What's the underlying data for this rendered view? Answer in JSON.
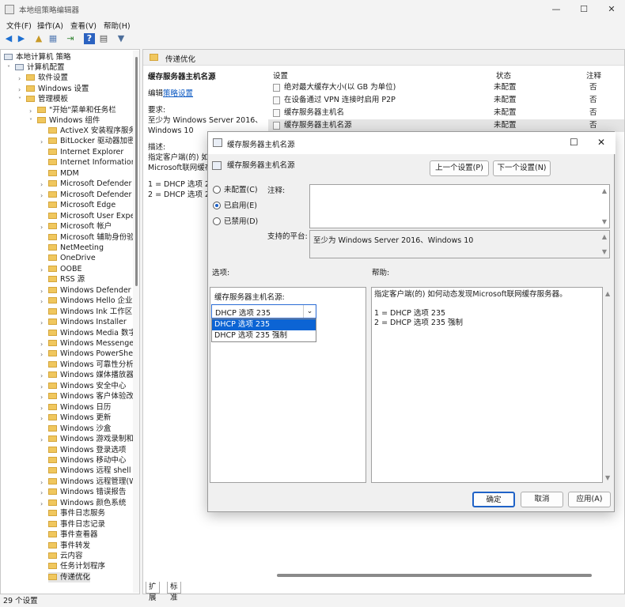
{
  "window": {
    "title": "本地组策略编辑器",
    "minimize": "—",
    "maximize": "☐",
    "close": "✕"
  },
  "menu": [
    "文件(F)",
    "操作(A)",
    "查看(V)",
    "帮助(H)"
  ],
  "tree": {
    "root": "本地计算机 策略",
    "computer_config": "计算机配置",
    "software_settings": "软件设置",
    "windows_settings": "Windows 设置",
    "admin_templates": "管理模板",
    "start_menu": "\"开始\"菜单和任务栏",
    "windows_components": "Windows 组件",
    "items": [
      "ActiveX 安装程序服务",
      "BitLocker 驱动器加密",
      "Internet Explorer",
      "Internet Information S",
      "MDM",
      "Microsoft Defender 攻",
      "Microsoft Defender 防",
      "Microsoft Edge",
      "Microsoft User Experie",
      "Microsoft 帐户",
      "Microsoft 辅助身份验证",
      "NetMeeting",
      "OneDrive",
      "OOBE",
      "RSS 源",
      "Windows Defender Sr",
      "Windows Hello 企业版",
      "Windows Ink 工作区",
      "Windows Installer",
      "Windows Media 数字权",
      "Windows Messenger",
      "Windows PowerShell",
      "Windows 可靠性分析",
      "Windows 媒体播放器",
      "Windows 安全中心",
      "Windows 客户体验改善",
      "Windows 日历",
      "Windows 更新",
      "Windows 沙盒",
      "Windows 游戏录制和广",
      "Windows 登录选项",
      "Windows 移动中心",
      "Windows 远程 shell",
      "Windows 远程管理(W",
      "Windows 错误报告",
      "Windows 颜色系统",
      "事件日志服务",
      "事件日志记录",
      "事件查看器",
      "事件转发",
      "云内容",
      "任务计划程序",
      "传递优化"
    ]
  },
  "right": {
    "header": "传递优化",
    "desc_title": "缓存服务器主机名源",
    "edit_prefix": "编辑",
    "edit_link": "策略设置",
    "req_label": "要求:",
    "req_text1": "至少为 Windows Server 2016、",
    "req_text2": "Windows 10",
    "desc_label": "描述:",
    "desc_line1": "指定客户端(的) 如何",
    "desc_line2": "Microsoft联网缓存",
    "opt1": "1 = DHCP 选项 23",
    "opt2": "2 = DHCP 选项 23",
    "columns": {
      "setting": "设置",
      "state": "状态",
      "note": "注释"
    },
    "rows": [
      {
        "name": "绝对最大缓存大小(以 GB 为单位)",
        "state": "未配置",
        "note": "否"
      },
      {
        "name": "在设备通过 VPN 连接时启用 P2P",
        "state": "未配置",
        "note": "否"
      },
      {
        "name": "缓存服务器主机名",
        "state": "未配置",
        "note": "否"
      },
      {
        "name": "缓存服务器主机名源",
        "state": "未配置",
        "note": "否"
      }
    ]
  },
  "tabs": [
    "扩展",
    "标准"
  ],
  "status": "29 个设置",
  "dialog": {
    "title": "缓存服务器主机名源",
    "policy": "缓存服务器主机名源",
    "prev": "上一个设置(P)",
    "next": "下一个设置(N)",
    "radios": [
      "未配置(C)",
      "已启用(E)",
      "已禁用(D)"
    ],
    "comment_label": "注释:",
    "platform_label": "支持的平台:",
    "platform_text": "至少为 Windows Server 2016、Windows 10",
    "options_label": "选项:",
    "help_label": "帮助:",
    "combo_label": "缓存服务器主机名源:",
    "combo_value": "DHCP 选项 235",
    "dropdown": [
      "DHCP 选项 235",
      "DHCP 选项 235 强制"
    ],
    "help_line1": "指定客户端(的) 如何动态发现Microsoft联网缓存服务器。",
    "help_line2": "1 = DHCP 选项 235",
    "help_line3": "2 = DHCP 选项 235 强制",
    "ok": "确定",
    "cancel": "取消",
    "apply": "应用(A)"
  }
}
